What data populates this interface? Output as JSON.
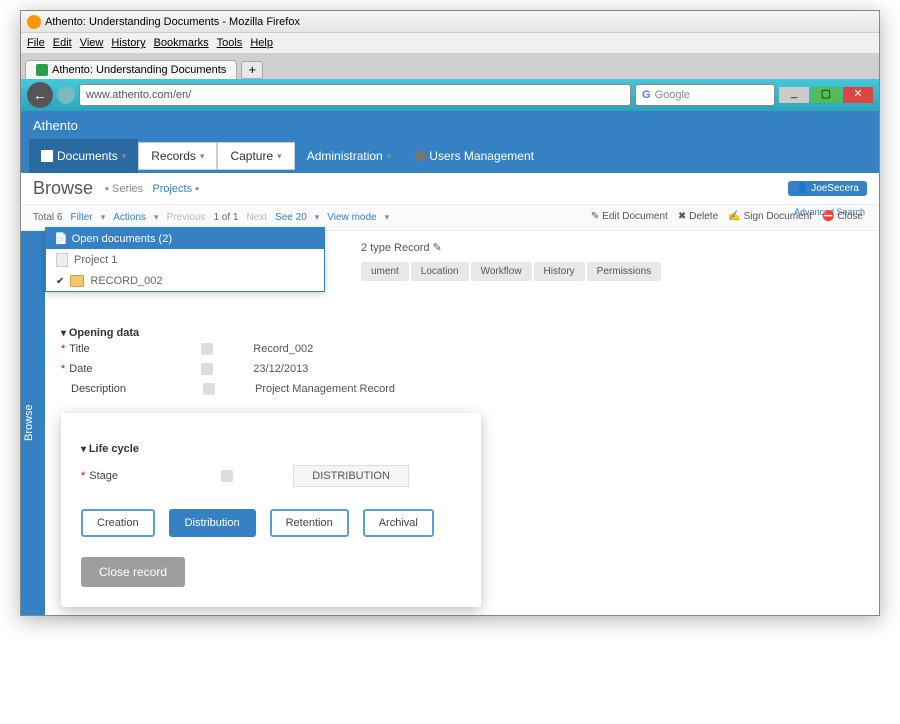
{
  "window": {
    "title": "Athento: Understanding Documents - Mozilla Firefox"
  },
  "menubar": [
    "File",
    "Edit",
    "View",
    "History",
    "Bookmarks",
    "Tools",
    "Help"
  ],
  "tab": {
    "label": "Athento: Understanding Documents"
  },
  "addressbar": {
    "url": "www.athento.com/en/",
    "search_placeholder": "Google"
  },
  "brand": "Athento",
  "nav": {
    "documents": "Documents",
    "records": "Records",
    "capture": "Capture",
    "administration": "Administration",
    "users": "Users Management"
  },
  "browse": {
    "title": "Browse",
    "crumb_series": "Series",
    "crumb_projects": "Projects",
    "user": "JoeSecera",
    "advanced_search": "Advanced Search"
  },
  "filter": {
    "total_label": "Total 6",
    "filter": "Filter",
    "actions": "Actions",
    "previous": "Previous",
    "page": "1 of 1",
    "next": "Next",
    "see": "See 20",
    "viewmode": "View mode"
  },
  "actions": {
    "edit": "Edit Document",
    "delete": "Delete",
    "sign": "Sign Document",
    "close": "Close"
  },
  "opendocs": {
    "header": "Open documents (2)",
    "items": [
      "Project 1",
      "RECORD_002"
    ]
  },
  "doctype": "2 type Record",
  "tabs": [
    "ument",
    "Location",
    "Workflow",
    "History",
    "Permissions"
  ],
  "opening": {
    "header": "Opening data",
    "title_lbl": "Title",
    "title_val": "Record_002",
    "date_lbl": "Date",
    "date_val": "23/12/2013",
    "desc_lbl": "Description",
    "desc_val": "Project Management Record"
  },
  "lifecycle": {
    "header": "Life cycle",
    "stage_lbl": "Stage",
    "stage_val": "DISTRIBUTION",
    "stages": [
      "Creation",
      "Distribution",
      "Retention",
      "Archival"
    ],
    "close_record": "Close record"
  },
  "sidetab": "Browse"
}
